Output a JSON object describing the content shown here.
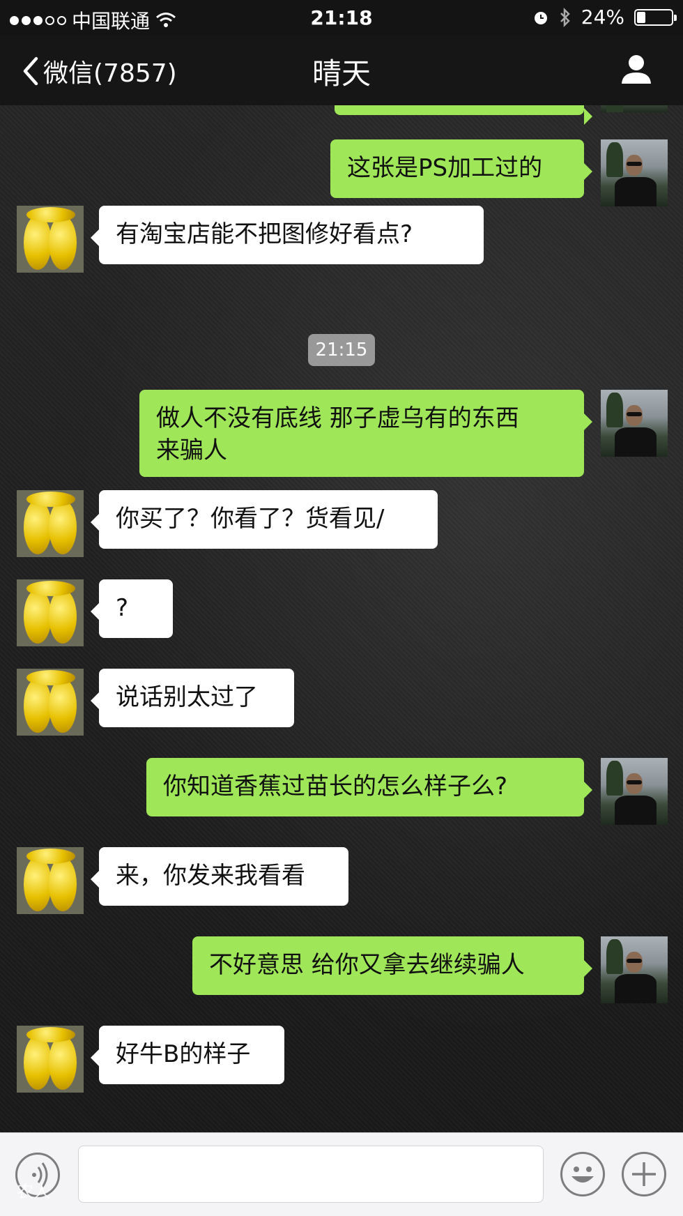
{
  "status_bar": {
    "carrier": "中国联通",
    "time": "21:18",
    "battery_percent": "24%",
    "battery_level": 0.24,
    "signal_dots_filled": 3,
    "signal_dots_total": 5,
    "icons": [
      "wifi-icon",
      "alarm-icon",
      "bluetooth-icon",
      "battery-icon"
    ]
  },
  "nav": {
    "back_label": "微信(7857)",
    "title": "晴天",
    "right_icon": "person-icon"
  },
  "chat": {
    "timestamp": "21:15",
    "messages": [
      {
        "side": "right",
        "text": "这张是PS加工过的"
      },
      {
        "side": "left",
        "text": "有淘宝店能不把图修好看点?"
      },
      {
        "side": "right",
        "line1": "做人不没有底线 那子虚乌有的东西",
        "line2": "来骗人"
      },
      {
        "side": "left",
        "text": "你买了？你看了？货看见/"
      },
      {
        "side": "left",
        "text": "?"
      },
      {
        "side": "left",
        "text": "说话别太过了"
      },
      {
        "side": "right",
        "text": "你知道香蕉过苗长的怎么样子么?"
      },
      {
        "side": "left",
        "text": "来，你发来我看看"
      },
      {
        "side": "right",
        "text": "不好意思 给你又拿去继续骗人"
      },
      {
        "side": "left",
        "text": "好牛B的样子"
      }
    ]
  },
  "input_bar": {
    "voice_icon": "voice-icon",
    "emoji_icon": "emoji-icon",
    "plus_icon": "plus-icon",
    "watermark": "农人"
  },
  "colors": {
    "sent_bubble": "#9fe658",
    "received_bubble": "#ffffff",
    "bar_background": "#161616"
  }
}
